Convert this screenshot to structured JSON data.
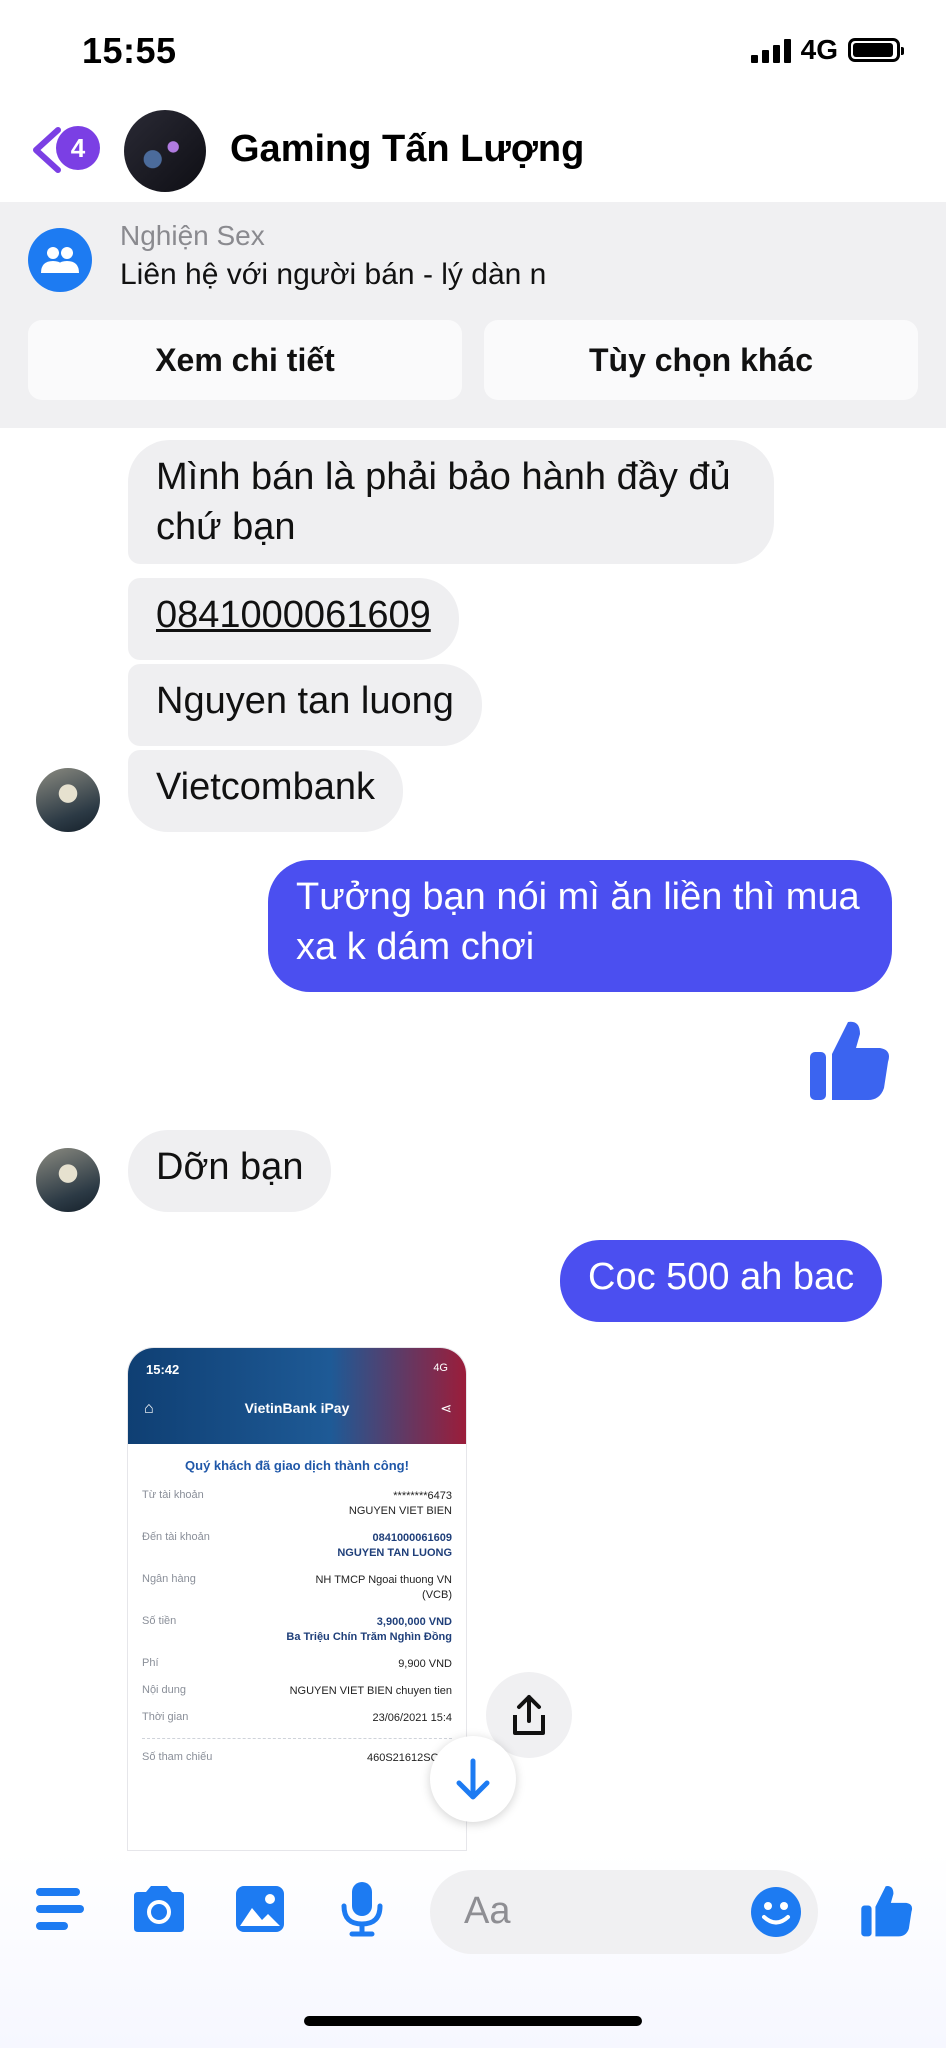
{
  "status_bar": {
    "time": "15:55",
    "network": "4G"
  },
  "header": {
    "back_count": "4",
    "title": "Gaming Tấn Lượng"
  },
  "marketplace": {
    "subtitle": "Nghiện Sex",
    "text": "Liên hệ với người bán - lý dàn n",
    "buttons": [
      "Xem chi tiết",
      "Tùy chọn khác"
    ]
  },
  "messages": {
    "m1": "Mình bán là phải bảo hành đầy đủ chứ bạn",
    "m2": "0841000061609",
    "m3": "Nguyen tan luong",
    "m4": "Vietcombank",
    "m5": "Tưởng bạn nói mì ăn liền thì mua xa k dám chơi",
    "m6": "Dỡn bạn",
    "m7": "Coc 500 ah bac"
  },
  "receipt": {
    "time": "15:42",
    "signal": "4G",
    "app_title": "VietinBank iPay",
    "success": "Quý khách đã giao dịch thành công!",
    "rows": [
      {
        "label": "Từ tài khoản",
        "value": "********6473",
        "value2": "NGUYEN VIET BIEN"
      },
      {
        "label": "Đến tài khoản",
        "value": "0841000061609",
        "value2": "NGUYEN TAN LUONG"
      },
      {
        "label": "Ngân hàng",
        "value": "NH TMCP Ngoai thuong VN",
        "value2": "(VCB)"
      },
      {
        "label": "Số tiền",
        "value": "3,900,000 VND",
        "value2": "Ba Triệu Chín Trăm Nghìn Đồng"
      },
      {
        "label": "Phí",
        "value": "9,900 VND"
      },
      {
        "label": "Nội dung",
        "value": "NGUYEN VIET BIEN chuyen tien"
      },
      {
        "label": "Thời gian",
        "value": "23/06/2021 15:4"
      }
    ],
    "ref_label": "Số tham chiếu",
    "ref_value": "460S21612SQJV"
  },
  "composer": {
    "placeholder": "Aa"
  },
  "colors": {
    "accent": "#1d7bf2",
    "outgoing": "#4b4ff0",
    "incoming": "#efeff1",
    "badge": "#7b3fe4"
  }
}
